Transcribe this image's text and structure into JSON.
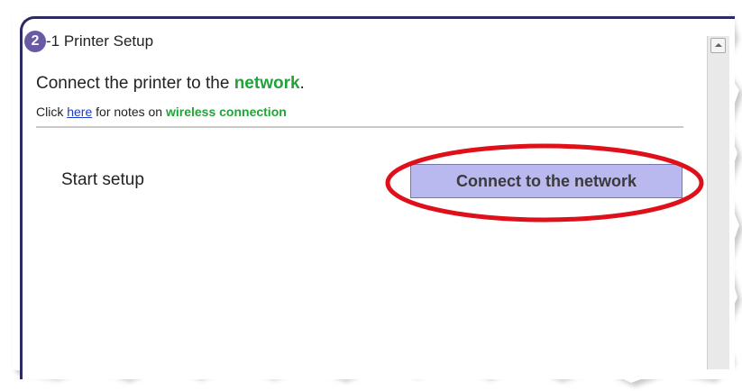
{
  "step": {
    "number": "2",
    "title": "-1 Printer Setup"
  },
  "heading": {
    "prefix": "Connect the printer to the ",
    "highlight": "network",
    "suffix": "."
  },
  "note": {
    "prefix": "Click ",
    "link_text": "here",
    "middle": " for notes on ",
    "highlight": "wireless connection"
  },
  "setup": {
    "label": "Start setup",
    "button_label": "Connect to the network"
  },
  "colors": {
    "frame": "#2c2a5e",
    "badge": "#6a5aa6",
    "accent_green": "#22a33a",
    "button_bg": "#b9b8ef",
    "highlight_ring": "#e0101a"
  }
}
